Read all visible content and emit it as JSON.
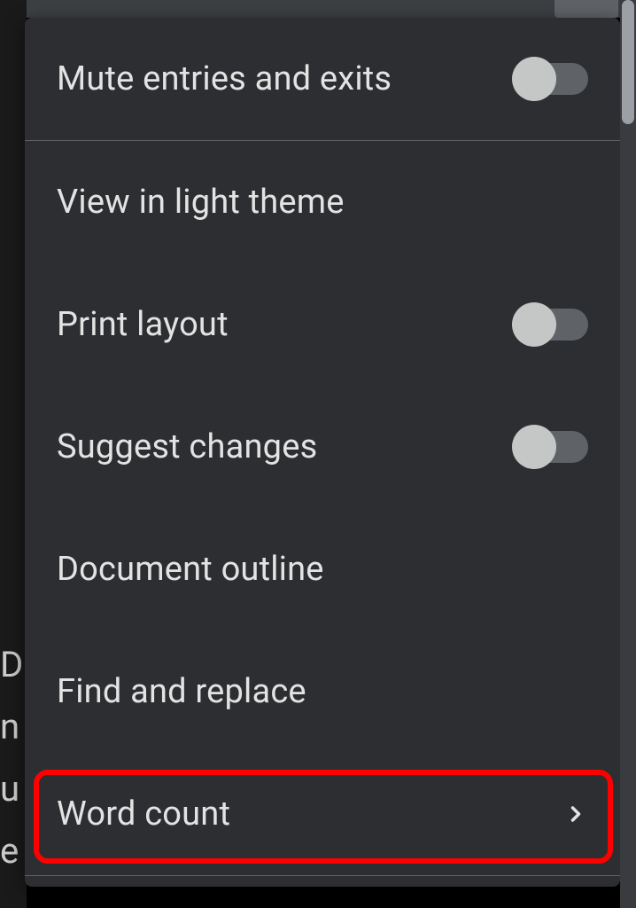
{
  "menu": {
    "items": [
      {
        "label": "Mute entries and exits",
        "has_toggle": true,
        "toggle_on": false
      },
      {
        "label": "View in light theme",
        "has_toggle": false
      },
      {
        "label": "Print layout",
        "has_toggle": true,
        "toggle_on": false
      },
      {
        "label": "Suggest changes",
        "has_toggle": true,
        "toggle_on": false
      },
      {
        "label": "Document outline",
        "has_toggle": false
      },
      {
        "label": "Find and replace",
        "has_toggle": false
      },
      {
        "label": "Word count",
        "has_toggle": false,
        "has_chevron": true,
        "highlighted": true
      }
    ]
  }
}
